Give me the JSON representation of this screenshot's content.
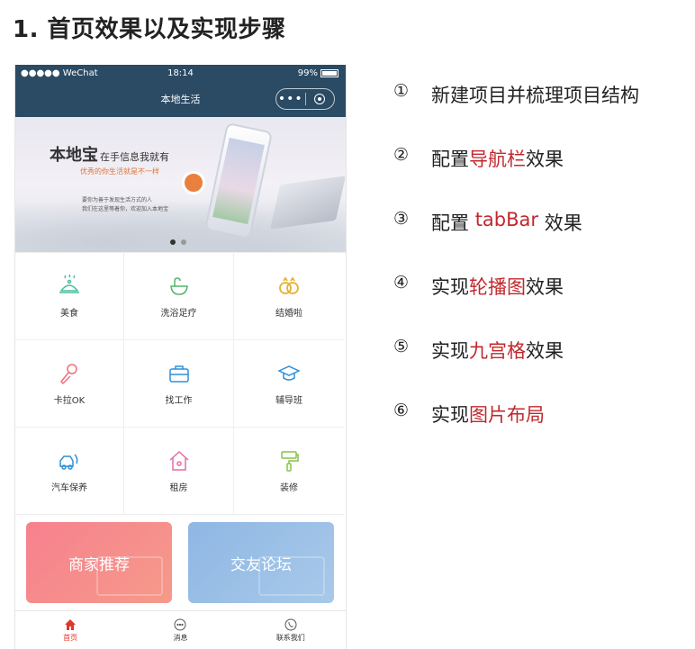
{
  "heading": "1. 首页效果以及实现步骤",
  "phone": {
    "status": {
      "carrier": "●●●●● WeChat",
      "time": "18:14",
      "battery": "99%"
    },
    "nav_title": "本地生活",
    "capsule_more": "•••",
    "banner": {
      "title": "本地宝",
      "title_small": "在手信息我就有",
      "subtitle": "优秀的你生活就是不一样",
      "desc_line1": "要你为善于发现生活方式的人",
      "desc_line2": "我们在这里等着你，欢迎加入本地宝"
    },
    "grid": [
      {
        "label": "美食",
        "icon": "food-icon",
        "color": "#4bbf9d"
      },
      {
        "label": "洗浴足疗",
        "icon": "bath-icon",
        "color": "#52b56a"
      },
      {
        "label": "结婚啦",
        "icon": "rings-icon",
        "color": "#e5b12f"
      },
      {
        "label": "卡拉OK",
        "icon": "microphone-icon",
        "color": "#ef6f7b"
      },
      {
        "label": "找工作",
        "icon": "briefcase-icon",
        "color": "#2f8fd8"
      },
      {
        "label": "辅导班",
        "icon": "graduation-cap-icon",
        "color": "#2f8fd8"
      },
      {
        "label": "汽车保养",
        "icon": "car-icon",
        "color": "#2f8fd8"
      },
      {
        "label": "租房",
        "icon": "house-icon",
        "color": "#e26fa6"
      },
      {
        "label": "装修",
        "icon": "paint-roller-icon",
        "color": "#8ac24a"
      }
    ],
    "cards": {
      "shop": "商家推荐",
      "friend": "交友论坛"
    },
    "tabs": [
      {
        "label": "首页",
        "icon": "home-icon"
      },
      {
        "label": "消息",
        "icon": "message-icon"
      },
      {
        "label": "联系我们",
        "icon": "phone-icon"
      }
    ]
  },
  "steps": [
    {
      "num": "①",
      "pre": "新建项目并梳理项目结构",
      "hl": "",
      "post": ""
    },
    {
      "num": "②",
      "pre": "配置",
      "hl": "导航栏",
      "post": "效果"
    },
    {
      "num": "③",
      "pre": "配置 ",
      "hl": "tabBar",
      "post": " 效果"
    },
    {
      "num": "④",
      "pre": "实现",
      "hl": "轮播图",
      "post": "效果"
    },
    {
      "num": "⑤",
      "pre": "实现",
      "hl": "九宫格",
      "post": "效果"
    },
    {
      "num": "⑥",
      "pre": "实现",
      "hl": "图片布局",
      "post": ""
    }
  ],
  "colors": {
    "highlight": "#c0282d",
    "navbar": "#2b4a63",
    "tab_active": "#e0362e"
  }
}
